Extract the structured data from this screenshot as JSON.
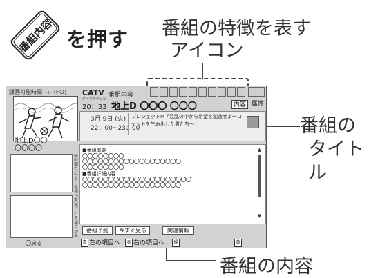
{
  "remote_button": {
    "label": "番組内容"
  },
  "press_text": "を押す",
  "callouts": {
    "features_line1": "番組の特徴を表す",
    "features_line2": "アイコン",
    "title_line1": "番組の",
    "title_line2": "タイトル",
    "content": "番組の内容"
  },
  "screen": {
    "rec_time": "録画可能時間 --:--(HD)",
    "channel_name_1": "地上D〇〇",
    "channel_name_2": "〇〇〇〇",
    "vertical_note": "局の都合により番組が変更される場合があります",
    "back_label": "〇戻る",
    "header": {
      "catv": "CATV",
      "subtitle": "番組内容",
      "cable": "ケーブルテレビ",
      "time": "20：33",
      "program": "地上D 〇〇〇 〇〇〇"
    },
    "tabs": {
      "naiyo": "内容",
      "zokusei": "属性"
    },
    "date": "3月 9日 (火)",
    "time_range": "22：00~23：00",
    "title": "プロジェクトM「混乱の中から希望を創造せよ～ロケットを生み出した男たち～」",
    "content": {
      "heading1": "■番組概要",
      "lines1": [
        "〇〇〇〇〇〇〇〇",
        "〇〇〇〇〇〇〇〇〇〇〇〇〇〇〇〇〇〇〇",
        "〇〇〇〇〇〇〇〇"
      ],
      "heading2": "■番組詳細内容",
      "lines2": [
        "〇〇〇〇〇〇〇〇〇〇〇〇〇〇〇〇〇〇〇〇〇",
        "〇〇〇〇〇〇〇〇〇〇〇〇〇〇〇〇〇〇〇"
      ]
    },
    "buttons": {
      "reserve": "番組予約",
      "watch_now": "今すぐ見る",
      "related": "関連情報"
    },
    "bottom": {
      "left_key": "青",
      "left_item": "左の項目へ",
      "right_key": "赤",
      "right_item": "右の項目へ",
      "green_key": "緑",
      "yellow_key": "黄"
    }
  },
  "colors": {
    "screen_bg": "#d2d2d2",
    "panel_bg": "#ededed"
  }
}
